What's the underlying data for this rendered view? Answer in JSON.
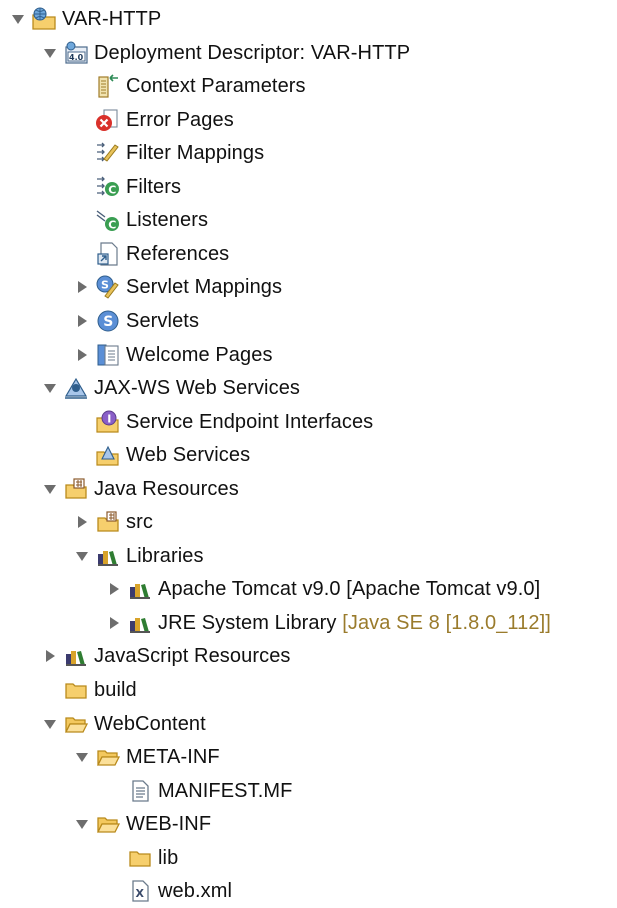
{
  "tree": [
    {
      "label": "VAR-HTTP",
      "depth": 0,
      "twisty": "expanded",
      "icon": "web-project-icon"
    },
    {
      "label": "Deployment Descriptor: VAR-HTTP",
      "depth": 1,
      "twisty": "expanded",
      "icon": "deployment-descriptor-icon"
    },
    {
      "label": "Context Parameters",
      "depth": 2,
      "twisty": "none",
      "icon": "context-parameters-icon"
    },
    {
      "label": "Error Pages",
      "depth": 2,
      "twisty": "none",
      "icon": "error-pages-icon"
    },
    {
      "label": "Filter Mappings",
      "depth": 2,
      "twisty": "none",
      "icon": "filter-mappings-icon"
    },
    {
      "label": "Filters",
      "depth": 2,
      "twisty": "none",
      "icon": "filters-icon"
    },
    {
      "label": "Listeners",
      "depth": 2,
      "twisty": "none",
      "icon": "listeners-icon"
    },
    {
      "label": "References",
      "depth": 2,
      "twisty": "none",
      "icon": "references-icon"
    },
    {
      "label": "Servlet Mappings",
      "depth": 2,
      "twisty": "collapsed",
      "icon": "servlet-mappings-icon"
    },
    {
      "label": "Servlets",
      "depth": 2,
      "twisty": "collapsed",
      "icon": "servlets-icon"
    },
    {
      "label": "Welcome Pages",
      "depth": 2,
      "twisty": "collapsed",
      "icon": "welcome-pages-icon"
    },
    {
      "label": "JAX-WS Web Services",
      "depth": 1,
      "twisty": "expanded",
      "icon": "jax-ws-icon"
    },
    {
      "label": "Service Endpoint Interfaces",
      "depth": 2,
      "twisty": "none",
      "icon": "service-endpoint-icon"
    },
    {
      "label": "Web Services",
      "depth": 2,
      "twisty": "none",
      "icon": "web-services-icon"
    },
    {
      "label": "Java Resources",
      "depth": 1,
      "twisty": "expanded",
      "icon": "java-resources-icon"
    },
    {
      "label": "src",
      "depth": 2,
      "twisty": "collapsed",
      "icon": "source-folder-icon"
    },
    {
      "label": "Libraries",
      "depth": 2,
      "twisty": "expanded",
      "icon": "libraries-icon"
    },
    {
      "label": "Apache Tomcat v9.0 [Apache Tomcat v9.0]",
      "depth": 3,
      "twisty": "collapsed",
      "icon": "library-icon"
    },
    {
      "label": "JRE System Library",
      "decoration": "[Java SE 8 [1.8.0_112]]",
      "depth": 3,
      "twisty": "collapsed",
      "icon": "library-icon"
    },
    {
      "label": "JavaScript Resources",
      "depth": 1,
      "twisty": "collapsed",
      "icon": "libraries-icon"
    },
    {
      "label": "build",
      "depth": 1,
      "twisty": "none",
      "icon": "folder-icon"
    },
    {
      "label": "WebContent",
      "depth": 1,
      "twisty": "expanded",
      "icon": "folder-open-icon"
    },
    {
      "label": "META-INF",
      "depth": 2,
      "twisty": "expanded",
      "icon": "folder-open-icon"
    },
    {
      "label": "MANIFEST.MF",
      "depth": 3,
      "twisty": "none",
      "icon": "text-file-icon"
    },
    {
      "label": "WEB-INF",
      "depth": 2,
      "twisty": "expanded",
      "icon": "folder-open-icon"
    },
    {
      "label": "lib",
      "depth": 3,
      "twisty": "none",
      "icon": "folder-icon"
    },
    {
      "label": "web.xml",
      "depth": 3,
      "twisty": "none",
      "icon": "xml-file-icon"
    }
  ]
}
